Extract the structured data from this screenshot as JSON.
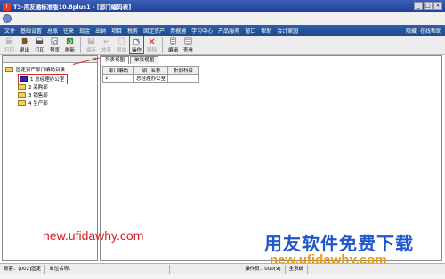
{
  "window": {
    "title": "T3-用友通标准版10.8plus1 - [部门编码表]",
    "buttons": [
      "_",
      "□",
      "×"
    ]
  },
  "menu": {
    "items": [
      "文件",
      "基础设置",
      "总账",
      "往来",
      "现金",
      "出纳",
      "项目",
      "税务",
      "固定资产",
      "票据通",
      "学习中心",
      "产品服务",
      "窗口",
      "帮助",
      "会计家园"
    ],
    "right_items": [
      "隐藏",
      "在线帮助"
    ]
  },
  "toolbar": {
    "buttons": [
      {
        "label": "打印",
        "icon": "printer-icon",
        "disabled": true
      },
      {
        "label": "退出",
        "icon": "exit-icon",
        "disabled": false
      },
      {
        "label": "打印",
        "icon": "print-icon",
        "disabled": false
      },
      {
        "label": "预览",
        "icon": "preview-icon",
        "disabled": false
      },
      {
        "label": "刷新",
        "icon": "refresh-icon",
        "disabled": false
      },
      {
        "label": "保存",
        "icon": "save-icon",
        "disabled": true
      },
      {
        "label": "放弃",
        "icon": "discard-icon",
        "disabled": true
      },
      {
        "label": "增加",
        "icon": "add-icon",
        "disabled": true
      },
      {
        "label": "操作",
        "icon": "operate-icon",
        "disabled": false
      },
      {
        "label": "删除",
        "icon": "delete-icon",
        "disabled": true
      },
      {
        "label": "编辑",
        "icon": "edit-icon",
        "disabled": false
      },
      {
        "label": "查看",
        "icon": "view-icon",
        "disabled": false
      }
    ]
  },
  "left_pane": {
    "header": "",
    "root": "固定资产部门编码目录",
    "items": [
      {
        "label": "1 总经理办公室",
        "selected": true
      },
      {
        "label": "2 采购部",
        "selected": false
      },
      {
        "label": "3 销售部",
        "selected": false
      },
      {
        "label": "4 生产部",
        "selected": false
      }
    ]
  },
  "right_pane": {
    "tabs": [
      "列表视图",
      "单张视图"
    ],
    "columns": [
      "部门编码",
      "部门名称",
      "折旧科目"
    ],
    "rows": [
      [
        "1",
        "总经理办公室",
        ""
      ]
    ]
  },
  "watermarks": {
    "url_red": "new.ufidawhy.com",
    "brand_blue": "用友软件免费下载",
    "url_orange": "new.ufidawhy.com"
  },
  "status": {
    "account": "账套：[002]固定",
    "unit": "单位名称：",
    "operator": "操作员：000(9)",
    "extra": "全系统"
  },
  "colors": {
    "titlebar": "#1f3f96",
    "menubar": "#1e4a8e",
    "highlight": "#d42a2a"
  }
}
